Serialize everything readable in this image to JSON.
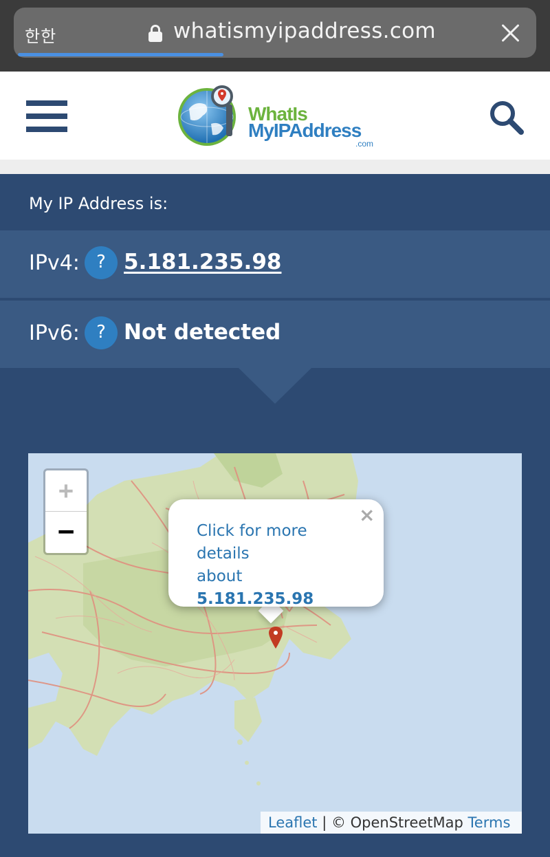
{
  "browser": {
    "reader_label": "한한",
    "url": "whatismyipaddress.com",
    "progress": 0.4
  },
  "site": {
    "logo_line1": "WhatIs",
    "logo_line2": "MyIPAddress",
    "logo_suffix": ".com"
  },
  "ip": {
    "heading": "My IP Address is:",
    "ipv4_label": "IPv4:",
    "ipv4_value": "5.181.235.98",
    "ipv6_label": "IPv6:",
    "ipv6_value": "Not detected",
    "help_glyph": "?"
  },
  "map": {
    "zoom_in": "+",
    "zoom_out": "−",
    "popup_close": "×",
    "popup_line1": "Click for more details",
    "popup_about": "about",
    "popup_ip": "5.181.235.98",
    "attribution_leaflet": "Leaflet",
    "attribution_sep": "| © OpenStreetMap",
    "attribution_terms": "Terms"
  },
  "colors": {
    "brand_navy": "#2d4a72",
    "row_blue": "#3a5a83",
    "accent_blue": "#2f7fc1",
    "logo_green": "#6cb33e",
    "marker_red": "#c23b22"
  }
}
